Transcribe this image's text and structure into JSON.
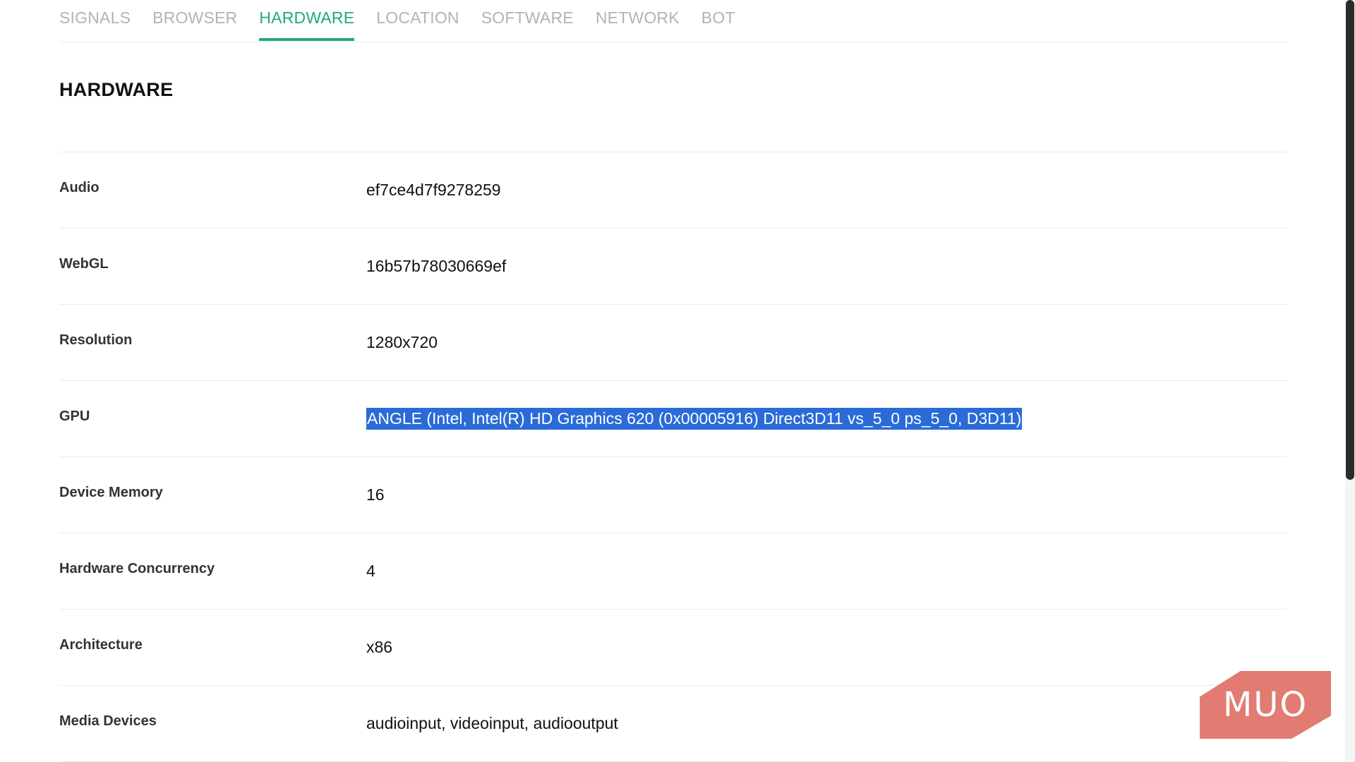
{
  "tabs": [
    {
      "label": "SIGNALS"
    },
    {
      "label": "BROWSER"
    },
    {
      "label": "HARDWARE",
      "active": true
    },
    {
      "label": "LOCATION"
    },
    {
      "label": "SOFTWARE"
    },
    {
      "label": "NETWORK"
    },
    {
      "label": "BOT"
    }
  ],
  "section": {
    "title": "HARDWARE"
  },
  "rows": [
    {
      "label": "Audio",
      "value": "ef7ce4d7f9278259"
    },
    {
      "label": "WebGL",
      "value": "16b57b78030669ef"
    },
    {
      "label": "Resolution",
      "value": "1280x720"
    },
    {
      "label": "GPU",
      "value": "ANGLE (Intel, Intel(R) HD Graphics 620 (0x00005916) Direct3D11 vs_5_0 ps_5_0, D3D11)"
    },
    {
      "label": "Device Memory",
      "value": "16"
    },
    {
      "label": "Hardware Concurrency",
      "value": "4"
    },
    {
      "label": "Architecture",
      "value": "x86"
    },
    {
      "label": "Media Devices",
      "value": "audioinput, videoinput, audiooutput"
    }
  ],
  "logo": {
    "text": "MUO",
    "color": "#e27b72"
  },
  "colors": {
    "accent": "#1fa97a",
    "selection": "#2a6bd8"
  }
}
